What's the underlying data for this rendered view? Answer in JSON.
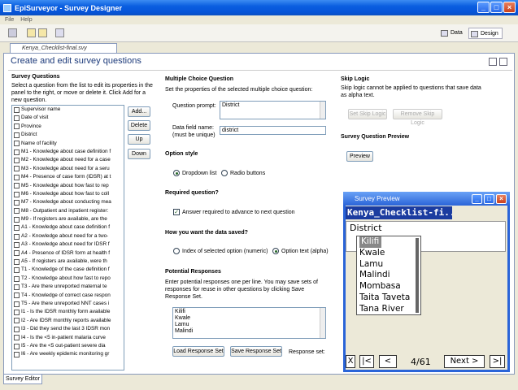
{
  "window": {
    "title": "EpiSurveyor - Survey Designer"
  },
  "menu": [
    "File",
    "Help"
  ],
  "toolbar": {
    "data_label": "Data",
    "design_label": "Design"
  },
  "doc_tab": "Kenya_Checklist-final.svy",
  "page_title": "Create and edit survey questions",
  "survey_questions": {
    "heading": "Survey Questions",
    "help": "Select a question from the list to edit its properties in the panel to the right, or move or delete it. Click Add for a new question.",
    "items": [
      "Supervisor name",
      "Date of visit",
      "Province",
      "District",
      "Name of facility",
      "M1 - Knowledge about case definition f",
      "M2 - Knowledge about need for a case",
      "M3 - Knowledge about need for a seru",
      "M4 - Presence of case form (IDSR) at t",
      "M5 - Knowledge about how fast to rep",
      "M6 - Knowledge about how fast to coll",
      "M7 - Knowledge about conducting mea",
      "M8 - Outpatient and inpatient register:",
      "M9 - If registers are available, are the",
      "A1 - Knowledge about case definition f",
      "A2 - Knowledge about need for a two-",
      "A3 - Knowledge about need for IDSR f",
      "A4 - Presence of IDSR form at health f",
      "A5 - If registers are available, were th",
      "T1 - Knowledge of the case definition f",
      "T2 - Knowledge about how fast to repo",
      "T3 - Are there unreported maternal te",
      "T4 - Knowledge of correct case respon",
      "T5 - Are there unreported NNT cases i",
      "I1 - Is the IDSR monthly form available",
      "I2 - Are IDSR monthly reports available",
      "I3 - Did they send the last 3 IDSR mon",
      "I4 - Is the <5 in-patient malaria curve",
      "I5 - Are the <5 out-patient severe dia",
      "I6 - Are weekly epidemic monitoring gr"
    ],
    "selected_index": 3,
    "buttons": {
      "add": "Add...",
      "delete": "Delete",
      "up": "Up",
      "down": "Down"
    }
  },
  "mcq": {
    "heading": "Multiple Choice Question",
    "help": "Set the properties of the selected multiple choice question:",
    "prompt_label": "Question prompt:",
    "prompt_value": "District",
    "field_label": "Data field name:",
    "field_label2": "(must be unique)",
    "field_value": "district",
    "style_heading": "Option style",
    "style_dropdown": "Dropdown list",
    "style_radio": "Radio buttons",
    "required_heading": "Required question?",
    "required_label": "Answer required to advance to next question",
    "saved_heading": "How you want the data saved?",
    "saved_index": "Index of selected option (numeric)",
    "saved_text": "Option text (alpha)",
    "responses_heading": "Potential Responses",
    "responses_help": "Enter potential responses one per line. You may save sets of responses for reuse in other questions by clicking Save Response Set.",
    "responses": [
      "Kilifi",
      "Kwale",
      "Lamu",
      "Malindi"
    ],
    "load_btn": "Load Response Set",
    "save_btn": "Save Response Set",
    "response_set_label": "Response set:"
  },
  "skip": {
    "heading": "Skip Logic",
    "help": "Skip logic cannot be applied to questions that save data as alpha text.",
    "set_btn": "Set Skip Logic",
    "remove_btn": "Remove Skip Logic"
  },
  "preview_section": {
    "heading": "Survey Question Preview",
    "btn": "Preview"
  },
  "preview_window": {
    "title": "Survey Preview",
    "header": "Kenya_Checklist-fi...",
    "question": "District",
    "options": [
      "Kilifi",
      "Kwale",
      "Lamu",
      "Malindi",
      "Mombasa",
      "Taita Taveta",
      "Tana River"
    ],
    "nav": {
      "x": "X",
      "first": "|<",
      "prev": "<",
      "page": "4/61",
      "next": "Next >",
      "last": ">|"
    }
  },
  "bottom_tab": "Survey Editor"
}
